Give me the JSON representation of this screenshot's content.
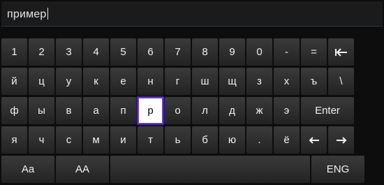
{
  "input": {
    "value": "пример"
  },
  "keyboard": {
    "row1": [
      "1",
      "2",
      "3",
      "4",
      "5",
      "6",
      "7",
      "8",
      "9",
      "0",
      "-",
      "="
    ],
    "row2": [
      "й",
      "ц",
      "у",
      "к",
      "е",
      "н",
      "г",
      "ш",
      "щ",
      "з",
      "х",
      "ъ",
      "\\"
    ],
    "row3": [
      "ф",
      "ы",
      "в",
      "а",
      "п",
      "р",
      "о",
      "л",
      "д",
      "ж",
      "э"
    ],
    "row3_enter": "Enter",
    "row4": [
      "я",
      "ч",
      "с",
      "м",
      "и",
      "т",
      "ь",
      "б",
      "ю",
      ".",
      "ё"
    ],
    "row5": {
      "case_toggle": "Aa",
      "caps": "AA",
      "space": "",
      "lang": "ENG"
    },
    "selected_key": "р",
    "icons": {
      "backspace": "backspace-icon",
      "left": "arrow-left-icon",
      "right": "arrow-right-icon"
    },
    "colors": {
      "selected_border": "#6a3fc9",
      "key_bg": "#2e2e2e",
      "background": "#0d0d0d"
    }
  }
}
